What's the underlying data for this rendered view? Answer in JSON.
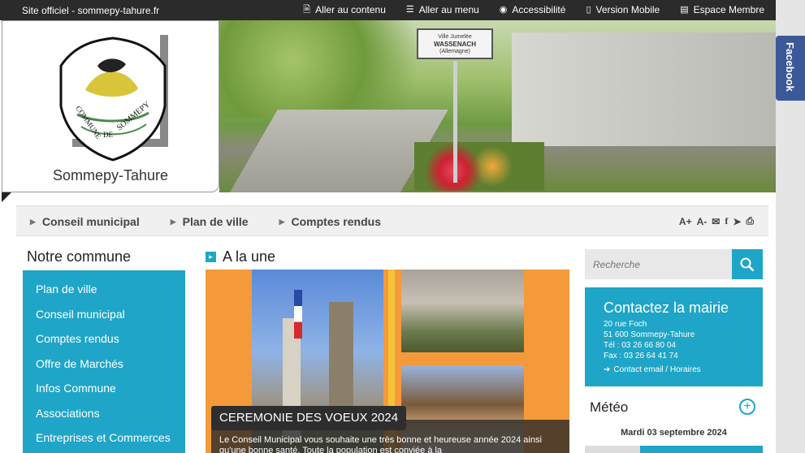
{
  "topbar": {
    "site_label": "Site officiel - sommepy-tahure.fr",
    "links": [
      {
        "label": "Aller au contenu",
        "icon": "document-icon"
      },
      {
        "label": "Aller au menu",
        "icon": "menu-list-icon"
      },
      {
        "label": "Accessibilité",
        "icon": "eye-icon"
      },
      {
        "label": "Version Mobile",
        "icon": "mobile-icon"
      },
      {
        "label": "Espace Membre",
        "icon": "member-card-icon"
      }
    ]
  },
  "logo": {
    "town_name": "Sommepy-Tahure",
    "emblem_text": "COMMUNE DE SOMMEPY"
  },
  "hero": {
    "sign_line1": "Ville Jumelée",
    "sign_line2": "WASSENACH",
    "sign_line3": "(Allemagne)"
  },
  "facebook": {
    "label": "Facebook"
  },
  "nav": {
    "items": [
      "Conseil municipal",
      "Plan de ville",
      "Comptes rendus"
    ],
    "tools": {
      "font_up": "A+",
      "font_down": "A-"
    }
  },
  "left": {
    "heading": "Notre commune",
    "menu": [
      "Plan de ville",
      "Conseil municipal",
      "Comptes rendus",
      "Offre de Marchés",
      "Infos Commune",
      "Associations",
      "Entreprises et Commerces"
    ]
  },
  "une": {
    "heading": "A la une",
    "caption": "CEREMONIE DES VOEUX 2024",
    "text": "Le Conseil Municipal vous souhaite une très bonne et heureuse année 2024 ainsi qu'une bonne santé. Toute la population est conviée à la"
  },
  "search": {
    "placeholder": "Recherche"
  },
  "contact": {
    "title": "Contactez la mairie",
    "address1": "20 rue Foch",
    "address2": "51 600 Sommepy-Tahure",
    "tel": "Tél : 03 26 66 80 04",
    "fax": "Fax : 03 26 64 41 74",
    "link": "Contact email / Horaires"
  },
  "meteo": {
    "heading": "Météo",
    "date": "Mardi 03 septembre 2024"
  },
  "colors": {
    "accent": "#1fa5c7",
    "topbar": "#2b2b2b",
    "orange": "#f59a3a",
    "facebook": "#3b5998"
  }
}
